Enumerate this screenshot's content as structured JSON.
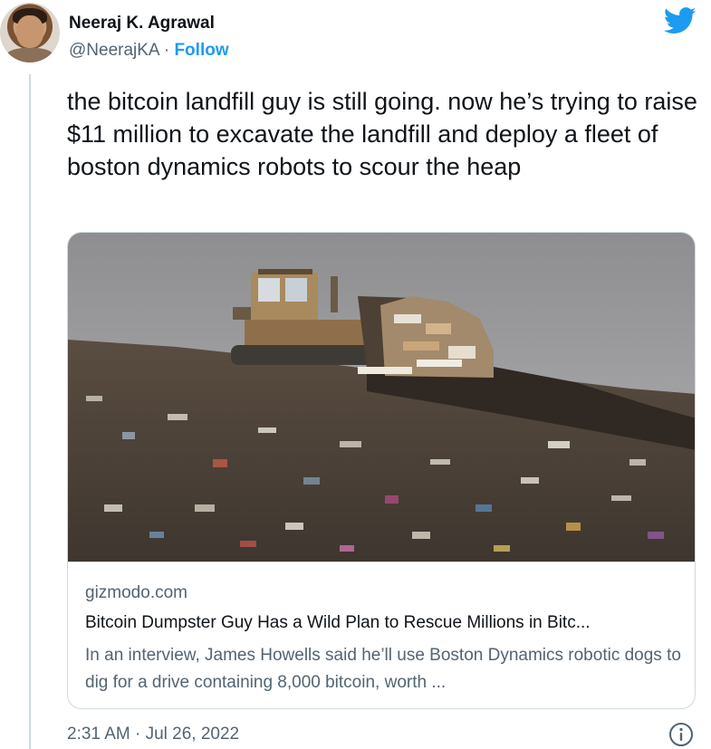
{
  "author": {
    "name": "Neeraj K. Agrawal",
    "handle": "@NeerajKA",
    "separator": "·",
    "follow_label": "Follow"
  },
  "icons": {
    "brand": "twitter-bird-icon",
    "info": "info-icon"
  },
  "tweet": {
    "text": "the bitcoin landfill guy is still going. now he’s trying to raise $11 million to excavate the landfill and deploy a fleet of boston dynamics robots to scour the heap"
  },
  "card": {
    "domain": "gizmodo.com",
    "title": "Bitcoin Dumpster Guy Has a Wild Plan to Rescue Millions in Bitc...",
    "description": "In an interview, James Howells said he’ll use Boston Dynamics robotic dogs to dig for a drive containing 8,000 bitcoin, worth ..."
  },
  "timestamp": "2:31 AM · Jul 26, 2022",
  "colors": {
    "brand_blue": "#1d9bf0",
    "text": "#0f1419",
    "secondary": "#536471",
    "border": "#cfd9de"
  }
}
